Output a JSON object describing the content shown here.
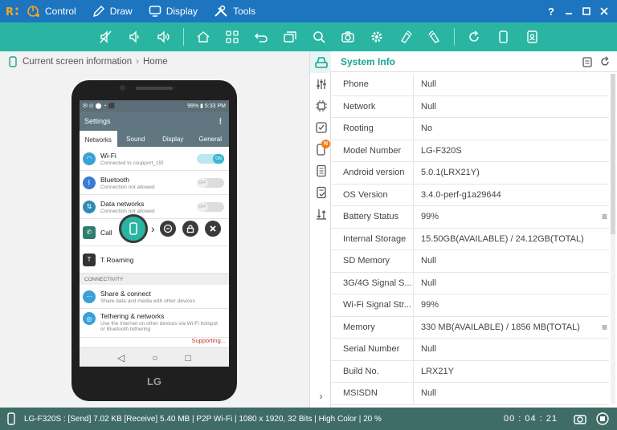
{
  "menu": {
    "items": [
      {
        "label": "Control",
        "icon": "control-icon"
      },
      {
        "label": "Draw",
        "icon": "pen-icon"
      },
      {
        "label": "Display",
        "icon": "monitor-icon"
      },
      {
        "label": "Tools",
        "icon": "tools-icon"
      }
    ],
    "help": "?"
  },
  "toolbar": {
    "icons": [
      "mute-icon",
      "volume-down-icon",
      "volume-up-icon",
      "home-icon",
      "apps-icon",
      "back-icon",
      "recent-apps-icon",
      "search-icon",
      "camera-icon",
      "settings-icon",
      "rotate-left-icon",
      "rotate-right-icon",
      "refresh-icon",
      "portrait-icon",
      "screen-icon"
    ]
  },
  "breadcrumb": {
    "current": "Current screen information",
    "page": "Home"
  },
  "device": {
    "brand": "LG",
    "statusbar": {
      "battery": "99%",
      "time": "5:33 PM"
    },
    "app_title": "Settings",
    "tabs": [
      "Networks",
      "Sound",
      "Display",
      "General"
    ],
    "rows": [
      {
        "title": "Wi-Fi",
        "sub": "Connected to csupport_15f",
        "toggle": "ON",
        "color": "#3aa0d8"
      },
      {
        "title": "Bluetooth",
        "sub": "Connection not allowed",
        "toggle": "OFF",
        "color": "#3a7bd5"
      },
      {
        "title": "Data networks",
        "sub": "Connection not allowed",
        "toggle": "OFF",
        "color": "#2e8bb8"
      },
      {
        "title": "Call",
        "sub": "",
        "toggle": "",
        "color": "#2e7d6f"
      },
      {
        "title": "T Roaming",
        "sub": "",
        "toggle": "",
        "color": "#333333"
      }
    ],
    "section": "CONNECTIVITY",
    "rows2": [
      {
        "title": "Share & connect",
        "sub": "Share data and media with other devices",
        "color": "#3aa0d8"
      },
      {
        "title": "Tethering & networks",
        "sub": "Use the Internet on other devices via Wi-Fi hotspot or Bluetooth tethering",
        "color": "#3aa0d8"
      }
    ],
    "supporting": "Supporting...",
    "toggle_on": "ON",
    "toggle_off": "OFF"
  },
  "info": {
    "title": "System Info",
    "rows": [
      {
        "key": "Phone",
        "value": "Null"
      },
      {
        "key": "Network",
        "value": "Null"
      },
      {
        "key": "Rooting",
        "value": "No"
      },
      {
        "key": "Model Number",
        "value": "LG-F320S"
      },
      {
        "key": "Android version",
        "value": "5.0.1(LRX21Y)"
      },
      {
        "key": "OS Version",
        "value": "3.4.0-perf-g1a29644"
      },
      {
        "key": "Battery Status",
        "value": "99%",
        "menu": true
      },
      {
        "key": "Internal Storage",
        "value": "15.50GB(AVAILABLE) / 24.12GB(TOTAL)"
      },
      {
        "key": "SD Memory",
        "value": "Null"
      },
      {
        "key": "3G/4G Signal S...",
        "value": "Null"
      },
      {
        "key": "Wi-Fi Signal Str...",
        "value": "99%"
      },
      {
        "key": "Memory",
        "value": "330 MB(AVAILABLE) / 1856 MB(TOTAL)",
        "menu": true
      },
      {
        "key": "Serial Number",
        "value": "Null"
      },
      {
        "key": "Build No.",
        "value": "LRX21Y"
      },
      {
        "key": "MSISDN",
        "value": "Null"
      }
    ]
  },
  "status": {
    "text": "LG-F320S : [Send] 7.02 KB  [Receive] 5.40 MB | P2P Wi-Fi | 1080 x 1920, 32 Bits | High Color | 20 %",
    "time": "00 : 04 : 21"
  },
  "colors": {
    "titlebar": "#1c75be",
    "toolbar": "#29b5a2",
    "accent": "#1aa391",
    "statusbar": "#3f6c66",
    "badge": "#f07c18"
  },
  "sidebar": {
    "badge": "N"
  }
}
